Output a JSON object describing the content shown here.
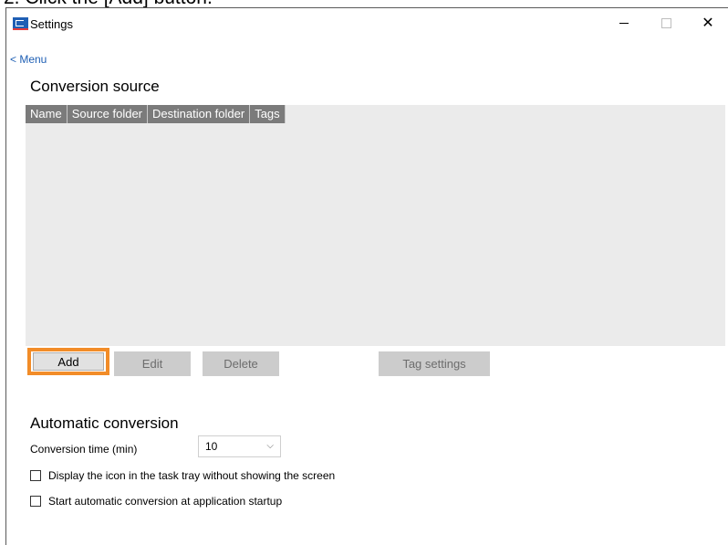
{
  "caption": "2.   Click the [Add] button.",
  "window": {
    "title": "Settings",
    "minimize_glyph": "—",
    "maximize_glyph": "",
    "close_glyph": "✕"
  },
  "menu_link": "< Menu",
  "conversion_source": {
    "title": "Conversion source",
    "columns": [
      "Name",
      "Source folder",
      "Destination folder",
      "Tags"
    ],
    "buttons": {
      "add": "Add",
      "edit": "Edit",
      "delete": "Delete",
      "tag_settings": "Tag settings"
    }
  },
  "automatic_conversion": {
    "title": "Automatic conversion",
    "time_label": "Conversion time (min)",
    "time_value": "10",
    "tray_option": "Display the icon in the task tray without showing the screen",
    "startup_option": "Start automatic conversion at application startup"
  },
  "highlight_color": "#f28c28"
}
